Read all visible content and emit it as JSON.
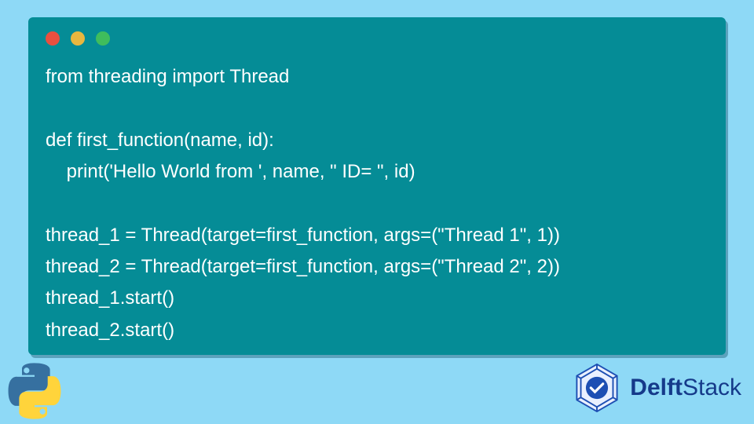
{
  "code": {
    "line1": "from threading import Thread",
    "line2": "",
    "line3": "def first_function(name, id):",
    "line4": "    print('Hello World from ', name, \" ID= \", id)",
    "line5": "",
    "line6": "thread_1 = Thread(target=first_function, args=(\"Thread 1\", 1))",
    "line7": "thread_2 = Thread(target=first_function, args=(\"Thread 2\", 2))",
    "line8": "thread_1.start()",
    "line9": "thread_2.start()"
  },
  "window": {
    "dot_red": "#e94f3f",
    "dot_yellow": "#e9b73f",
    "dot_green": "#3fbd5d",
    "code_bg": "#058c96",
    "page_bg": "#8ed9f6"
  },
  "brand": {
    "name_bold": "Delft",
    "name_light": "Stack",
    "color": "#153a8a"
  },
  "icons": {
    "python": "python-logo",
    "brand_badge": "delftstack-badge"
  }
}
